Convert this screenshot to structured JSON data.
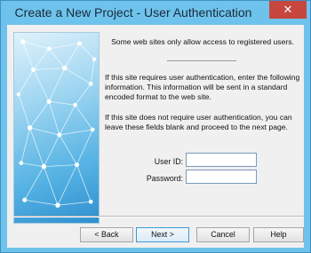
{
  "window": {
    "title": "Create a New Project - User Authentication",
    "close_icon": "close-icon"
  },
  "content": {
    "intro": "Some web sites only allow access to registered users.",
    "para1": "If this site requires user authentication, enter the following information. This information will be sent in a standard encoded format to the web site.",
    "para2": "If this site does not require user authentication, you can leave these fields blank and proceed to the next page."
  },
  "form": {
    "user_id_label": "User ID:",
    "user_id_value": "",
    "password_label": "Password:",
    "password_value": ""
  },
  "buttons": {
    "back": "< Back",
    "next": "Next >",
    "cancel": "Cancel",
    "help": "Help"
  },
  "colors": {
    "titlebar": "#6ec3ec",
    "close_button": "#c7463f",
    "dialog_background": "#f0f0f0"
  }
}
